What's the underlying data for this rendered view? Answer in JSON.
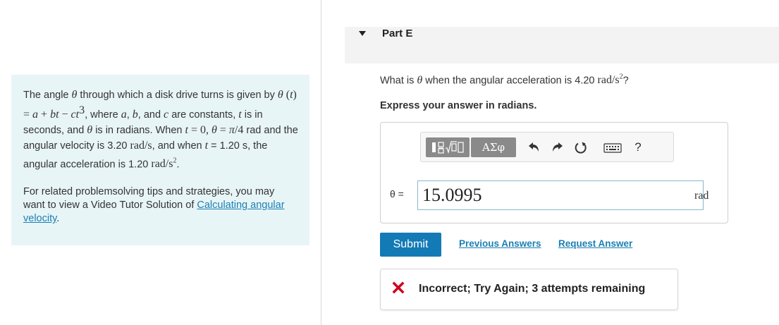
{
  "problem": {
    "text_1": "The angle",
    "text_2": "through which a disk drive turns is given by",
    "text_3": ", where",
    "text_4": "and",
    "text_5": "are constants,",
    "text_6": "is in seconds, and",
    "text_7": "is in radians. When",
    "text_8": "rad and the angular velocity is 3.20",
    "text_9": ", and when",
    "text_10": "= 1.20 s, the angular acceleration is 1.20",
    "tips_text": "For related problemsolving tips and strategies, you may want to view a Video Tutor Solution of",
    "tutor_link": "Calculating angular velocity"
  },
  "part": {
    "title": "Part E",
    "question_before": "What is",
    "question_after": "when the angular acceleration is 4.20",
    "instructions": "Express your answer in radians."
  },
  "toolbar": {
    "greek_label": "ΑΣφ",
    "help_label": "?"
  },
  "answer": {
    "variable": "θ =",
    "value": "15.0995",
    "unit": "rad"
  },
  "actions": {
    "submit": "Submit",
    "previous_answers": "Previous Answers",
    "request_answer": "Request Answer"
  },
  "feedback": {
    "text": "Incorrect; Try Again; 3 attempts remaining"
  },
  "colors": {
    "panel_bg": "#e8f5f7",
    "submit_bg": "#137ab6",
    "link": "#1a7fb3",
    "error": "#d0021b"
  },
  "icons": [
    "templates-icon",
    "undo-icon",
    "redo-icon",
    "reset-icon",
    "keyboard-icon",
    "x-icon"
  ]
}
